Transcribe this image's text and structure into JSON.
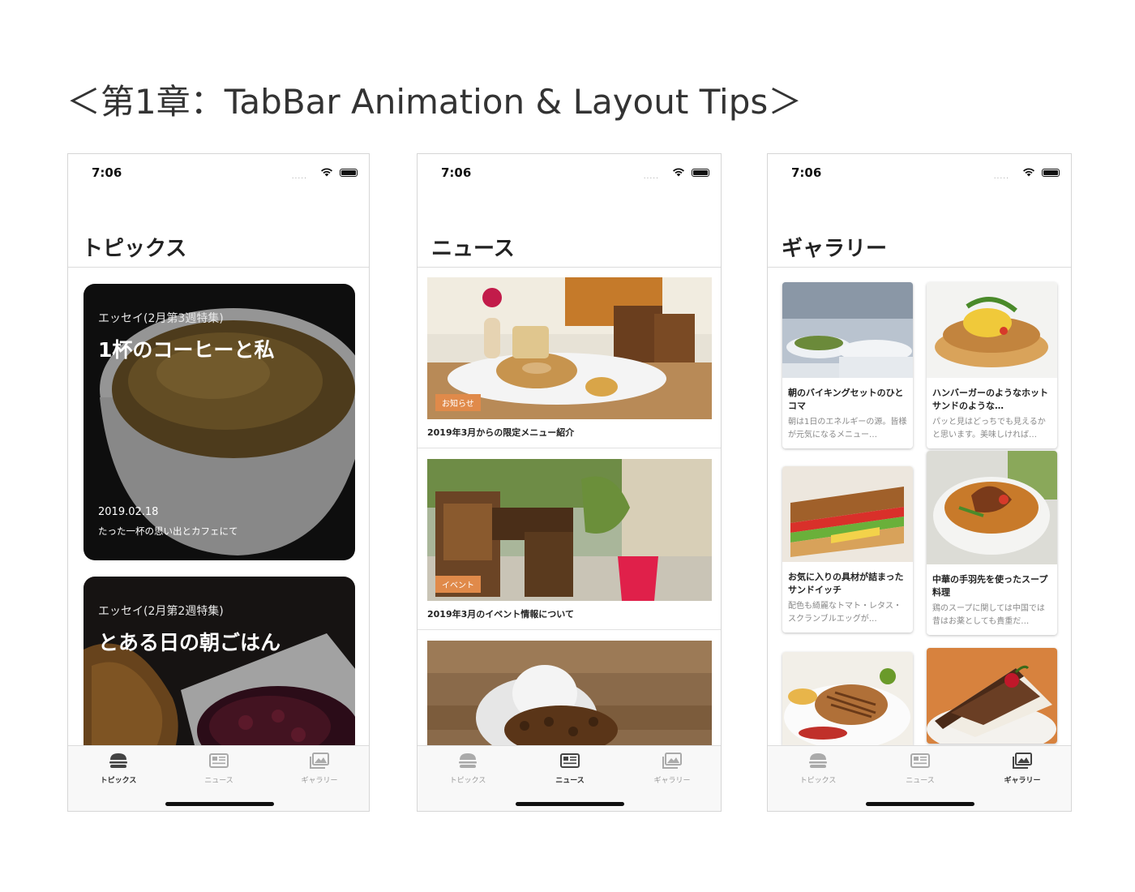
{
  "page_title": "＜第1章：TabBar Animation & Layout Tips＞",
  "status_time": "7:06",
  "status_signal": ".....",
  "tabs": [
    "トピックス",
    "ニュース",
    "ギャラリー"
  ],
  "screens": {
    "topics": {
      "title": "トピックス",
      "cards": [
        {
          "category": "エッセイ(2月第3週特集)",
          "title": "1杯のコーヒーと私",
          "date": "2019.02.18",
          "description": "たった一杯の思い出とカフェにて"
        },
        {
          "category": "エッセイ(2月第2週特集)",
          "title": "とある日の朝ごはん"
        }
      ]
    },
    "news": {
      "title": "ニュース",
      "items": [
        {
          "badge": "お知らせ",
          "title": "2019年3月からの限定メニュー紹介"
        },
        {
          "badge": "イベント",
          "title": "2019年3月のイベント情報について"
        },
        {
          "badge": "",
          "title": ""
        }
      ]
    },
    "gallery": {
      "title": "ギャラリー",
      "items": [
        {
          "title": "朝のバイキングセットのひとコマ",
          "description": "朝は1日のエネルギーの源。皆様が元気になるメニュー…"
        },
        {
          "title": "ハンバーガーのようなホットサンドのような…",
          "description": "パッと見はどっちでも見えるかと思います。美味しければ…"
        },
        {
          "title": "お気に入りの具材が詰まったサンドイッチ",
          "description": "配色も綺麗なトマト・レタス・スクランブルエッグが…"
        },
        {
          "title": "中華の手羽先を使ったスープ料理",
          "description": "鶏のスープに関しては中国では昔はお薬としても貴重だ…"
        }
      ]
    }
  },
  "colors": {
    "badge": "#e08a4a",
    "accent_text": "#333333",
    "inactive_tab": "#9a9a9a"
  },
  "icons": {
    "topics_tab": "burger-icon",
    "news_tab": "newspaper-icon",
    "gallery_tab": "photos-icon"
  }
}
